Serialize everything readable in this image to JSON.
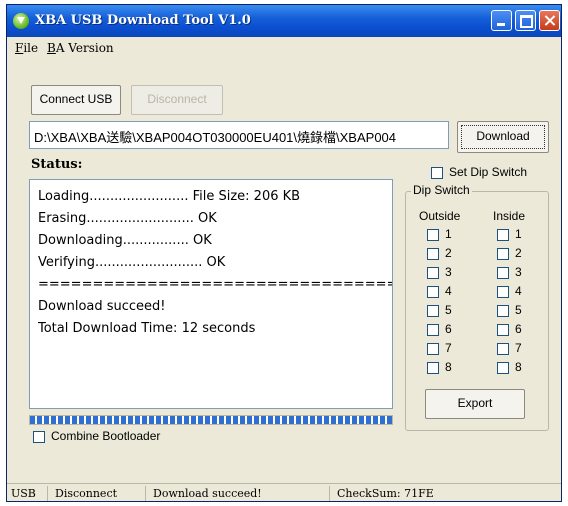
{
  "window": {
    "title": "XBA USB Download Tool V1.0"
  },
  "menu": {
    "items": [
      {
        "underline": "F",
        "rest": "ile"
      },
      {
        "underline": "B",
        "rest": "A Version"
      }
    ]
  },
  "buttons": {
    "connect": "Connect USB",
    "disconnect": "Disconnect",
    "download": "Download",
    "export": "Export"
  },
  "file_path": {
    "value": "D:\\XBA\\XBA送驗\\XBAP004OT030000EU401\\燒錄檔\\XBAP004"
  },
  "status": {
    "label": "Status:",
    "log": [
      "Loading........................ File Size: 206 KB",
      "Erasing.......................... OK",
      "Downloading................ OK",
      "Verifying.......................... OK",
      "======================================",
      "Download succeed!",
      "Total Download Time: 12 seconds"
    ]
  },
  "progress": {
    "value": 1.0
  },
  "options": {
    "combine_bootloader": "Combine Bootloader",
    "set_dip_switch": "Set Dip Switch"
  },
  "dip_switch": {
    "legend": "Dip Switch",
    "outside_label": "Outside",
    "inside_label": "Inside",
    "outside": [
      "1",
      "2",
      "3",
      "4",
      "5",
      "6",
      "7",
      "8"
    ],
    "inside": [
      "1",
      "2",
      "3",
      "4",
      "5",
      "6",
      "7",
      "8"
    ]
  },
  "statusbar": {
    "mode": "USB",
    "connection": "Disconnect",
    "message": "Download succeed!",
    "checksum": "CheckSum: 71FE"
  },
  "colors": {
    "titlebar": "#0b4fd0",
    "window_bg": "#ece9d8",
    "progress": "#2f6fd0"
  },
  "icons": {
    "app": "app-icon",
    "minimize": "minimize-icon",
    "maximize": "maximize-icon",
    "close": "close-icon"
  }
}
